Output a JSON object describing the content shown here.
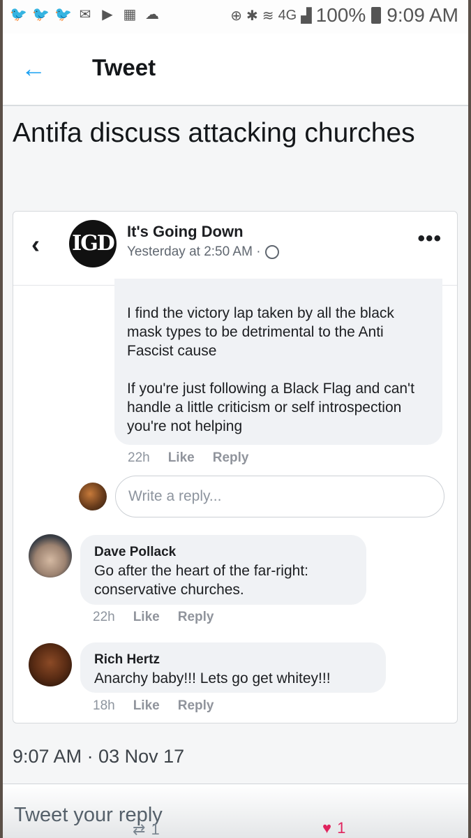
{
  "status_bar": {
    "notification_icons": [
      "twitter-icon",
      "twitter-icon",
      "twitter-icon",
      "mail-icon",
      "youtube-icon",
      "calendar-icon",
      "cloud-icon"
    ],
    "network": "4G",
    "battery": "100%",
    "time": "9:09 AM"
  },
  "header": {
    "back_icon": "back-arrow-icon",
    "title": "Tweet",
    "accent_color": "#1da1f2"
  },
  "tweet": {
    "text": "Antifa discuss attacking churches",
    "timestamp": "9:07 AM · 03 Nov 17"
  },
  "embedded_post": {
    "page_name": "It's Going Down",
    "page_logo_text": "IGD",
    "post_time": "Yesterday at 2:50 AM ·",
    "comments": [
      {
        "paragraphs": [
          "I find the victory lap taken by all the black mask types to be detrimental to the Anti Fascist cause",
          "If you're just following a Black Flag and can't handle a little criticism or self introspection you're not helping"
        ],
        "age": "22h",
        "like": "Like",
        "reply": "Reply"
      },
      {
        "author": "Dave Pollack",
        "text": "Go after the heart of the far-right: conservative churches.",
        "age": "22h",
        "like": "Like",
        "reply": "Reply"
      },
      {
        "author": "Rich Hertz",
        "text": "Anarchy baby!!! Lets go get whitey!!!",
        "age": "18h",
        "like": "Like",
        "reply": "Reply"
      }
    ],
    "reply_placeholder": "Write a reply..."
  },
  "reply_bar": {
    "placeholder": "Tweet your reply",
    "retweet_count": "1",
    "like_count": "1",
    "like_color": "#e0245e"
  }
}
